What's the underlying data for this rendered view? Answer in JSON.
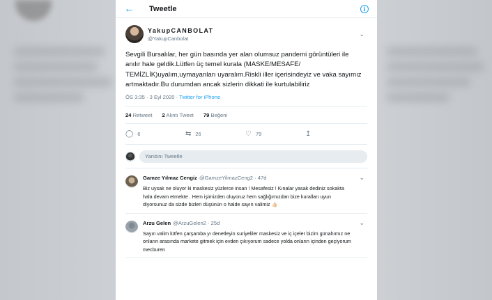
{
  "header": {
    "back_icon": "arrow-left-icon",
    "title": "Tweetle",
    "info_icon": "info-icon"
  },
  "tweet": {
    "author_name": "YakupCANBOLAT",
    "author_handle": "@YakupCanbolat",
    "text": "Sevgili Bursalılar, her gün basında yer alan olumsuz pandemi görüntüleri ile  anılır hale geldik.Lütfen üç temel kurala (MASKE/MESAFE/ TEMİZLİK)uyalım,uymayanları uyaralım.Riskli iller içerisindeyiz ve vaka sayımız artmaktadır.Bu durumdan ancak sizlerin dikkati ile kurtulabiliriz",
    "time": "ÖS 3:35 · 3 Eyl 2020 · ",
    "source": "Twitter for iPhone",
    "retweets_count": "24",
    "retweets_label": "Retweet",
    "quotes_count": "2",
    "quotes_label": "Alıntı Tweet",
    "likes_count": "79",
    "likes_label": "Beğeni",
    "reply_count": "6",
    "retweet_count_action": "26",
    "like_count_action": "79"
  },
  "reply_box": {
    "placeholder": "Yanıtını Tweetle"
  },
  "replies": [
    {
      "name": "Gamze Yılmaz Cengiz",
      "handle": "@GamzeYilmazCeng2 · 47d",
      "text": "Biz uysak ne oluyor ki maskesiz yüzlerce insan ! Mesafesiz ! Kınalar yasak dediniz sokakta hala devam etmekte . Hem işimizden oluyoruz hem sağlığımızdan bize kuralları uyun diyorsunuz da sizde bizleri düşünün o halde sayın valimiz 👍🏻"
    },
    {
      "name": "Arzu Gelen",
      "handle": "@ArzuGelen2 · 25d",
      "text": "Sayın valim lütfen çarşamba yı denetleyin suriyeliler maskesiz ve iç içeler bizim günahımız ne onların arasında markete gitmek için evden çıkıyorum sadece yolda onların içinden geçiyorum mecburen"
    }
  ],
  "colors": {
    "accent": "#1da1f2",
    "muted": "#657786",
    "text": "#14171a"
  }
}
